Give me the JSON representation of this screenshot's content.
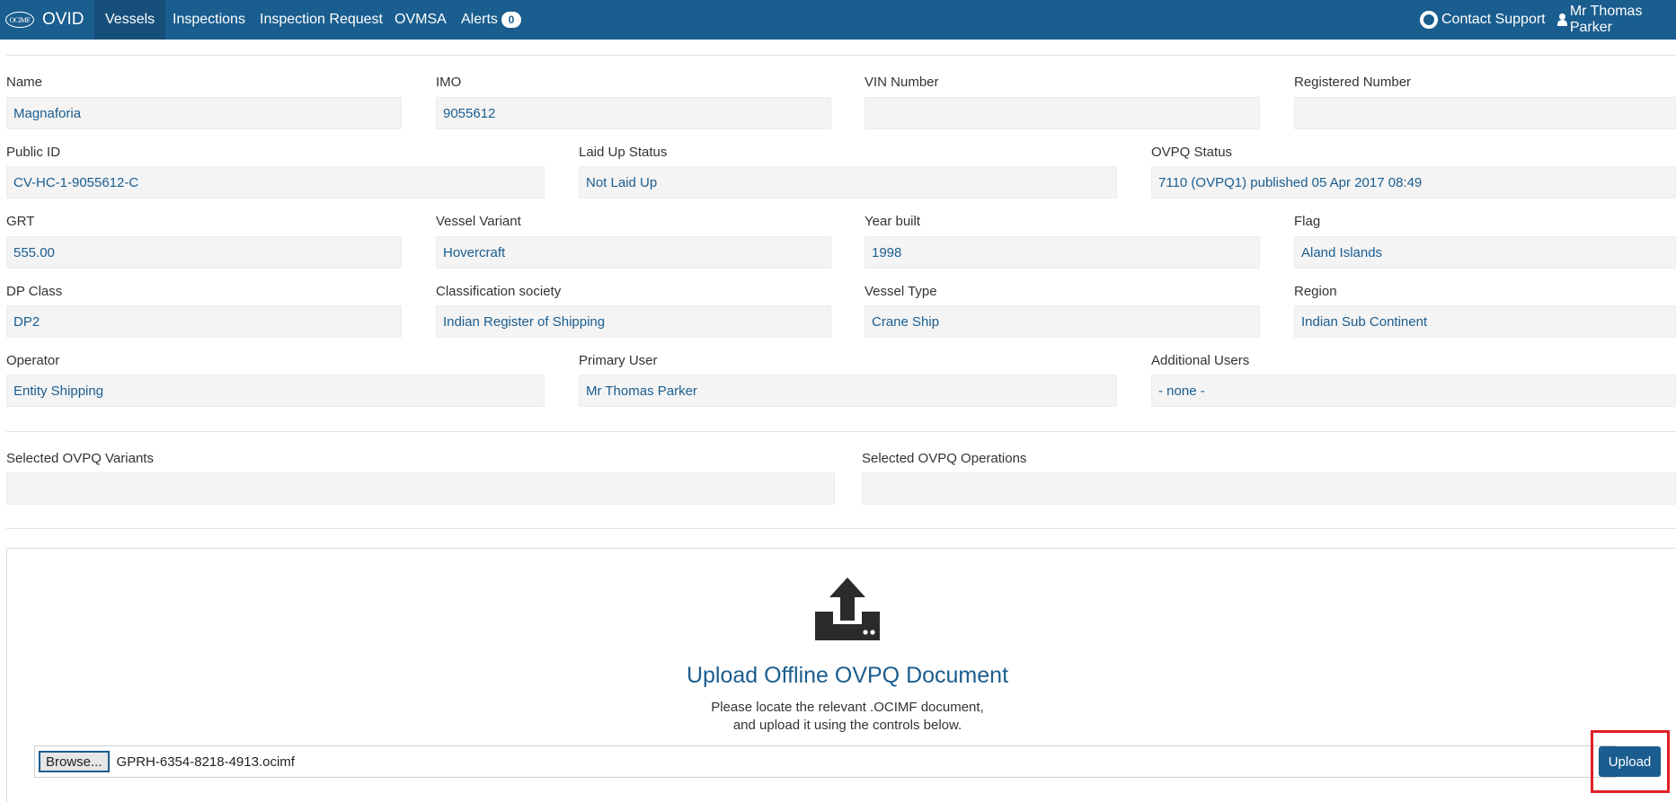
{
  "navbar": {
    "brand_logo": "OCIMF",
    "brand_name": "OVID",
    "items": [
      {
        "label": "Vessels",
        "active": true
      },
      {
        "label": "Inspections"
      },
      {
        "label": "Inspection Request"
      },
      {
        "label": "OVMSA"
      },
      {
        "label": "Alerts",
        "badge": "0"
      }
    ],
    "contact_support": "Contact Support",
    "user_name": "Mr Thomas Parker"
  },
  "vessel": {
    "name": {
      "label": "Name",
      "value": "Magnaforia"
    },
    "imo": {
      "label": "IMO",
      "value": "9055612"
    },
    "vin": {
      "label": "VIN Number",
      "value": ""
    },
    "registered_number": {
      "label": "Registered Number",
      "value": ""
    },
    "public_id": {
      "label": "Public ID",
      "value": "CV-HC-1-9055612-C"
    },
    "laid_up_status": {
      "label": "Laid Up Status",
      "value": "Not Laid Up"
    },
    "ovpq_status": {
      "label": "OVPQ Status",
      "value": "7110 (OVPQ1) published 05 Apr 2017 08:49"
    },
    "grt": {
      "label": "GRT",
      "value": "555.00"
    },
    "vessel_variant": {
      "label": "Vessel Variant",
      "value": "Hovercraft"
    },
    "year_built": {
      "label": "Year built",
      "value": "1998"
    },
    "flag": {
      "label": "Flag",
      "value": "Aland Islands"
    },
    "dp_class": {
      "label": "DP Class",
      "value": "DP2"
    },
    "classification_society": {
      "label": "Classification society",
      "value": "Indian Register of Shipping"
    },
    "vessel_type": {
      "label": "Vessel Type",
      "value": "Crane Ship"
    },
    "region": {
      "label": "Region",
      "value": "Indian Sub Continent"
    },
    "operator": {
      "label": "Operator",
      "value": "Entity Shipping"
    },
    "primary_user": {
      "label": "Primary User",
      "value": "Mr Thomas Parker"
    },
    "additional_users": {
      "label": "Additional Users",
      "value": "- none -"
    },
    "selected_variants": {
      "label": "Selected OVPQ Variants",
      "value": ""
    },
    "selected_operations": {
      "label": "Selected OVPQ Operations",
      "value": ""
    }
  },
  "upload": {
    "title": "Upload Offline OVPQ Document",
    "desc_line1": "Please locate the relevant .OCIMF document,",
    "desc_line2": "and upload it using the controls below.",
    "browse_label": "Browse...",
    "file_name": "GPRH-6354-8218-4913.ocimf",
    "upload_label": "Upload"
  },
  "colors": {
    "navbar": "#1a5d8f",
    "value_text": "#1a5d8f",
    "highlight": "#e01e26"
  }
}
